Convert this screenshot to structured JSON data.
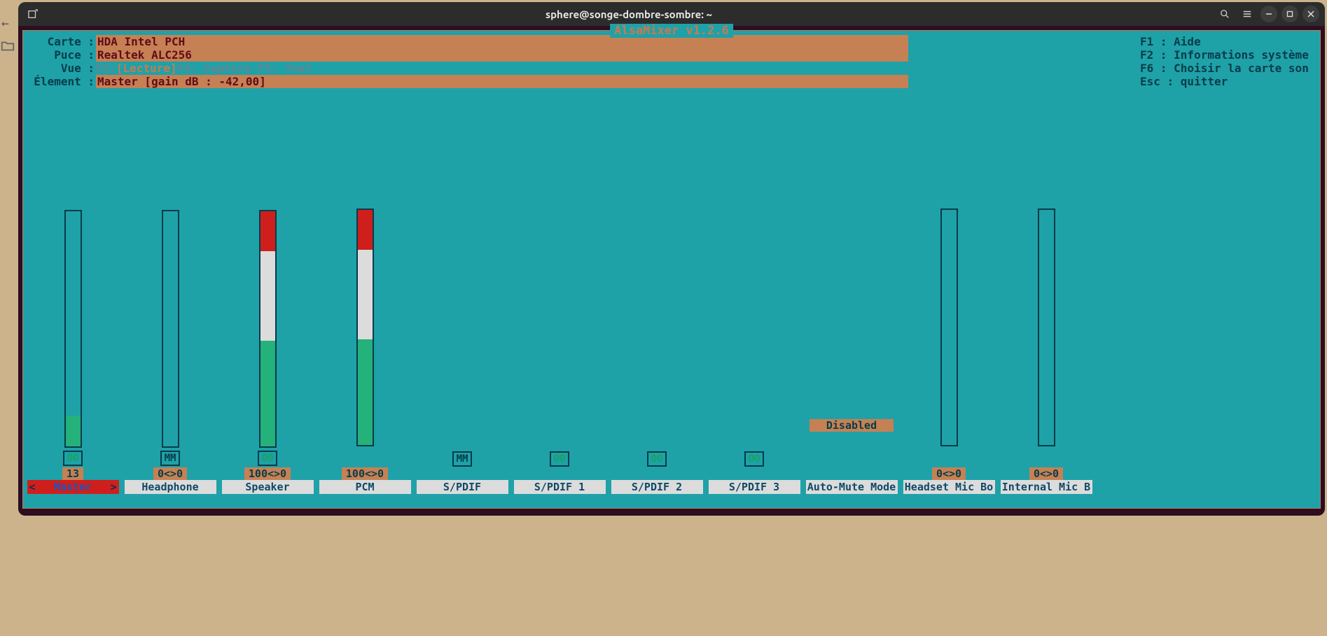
{
  "window": {
    "title": "sphere@songe-dombre-sombre: ~"
  },
  "alsamixer": {
    "frame_title": "AlsaMixer v1.2.6",
    "labels": {
      "carte": "Carte : ",
      "puce": "Puce : ",
      "vue": "Vue : ",
      "element": "Élement : "
    },
    "carte": "HDA Intel PCH",
    "puce": "Realtek ALC256",
    "view_prefix": "F3:",
    "view_selected": "[Lecture]",
    "view_rest": " F4: Capture  F5: Tout",
    "element": "Master [gain dB : -42,00]",
    "help": {
      "f1": "F1 :  Aide",
      "f2": "F2 :  Informations système",
      "f6": "F6 :  Choisir la carte son",
      "esc": "Esc : quitter"
    }
  },
  "channels": [
    {
      "name": "Master",
      "has_bar": true,
      "level": 13,
      "green": 13,
      "white": 0,
      "red": 0,
      "mute": "OO",
      "mute_cls": "mute-oo",
      "num": "13",
      "selected": true
    },
    {
      "name": "Headphone",
      "has_bar": true,
      "level": 0,
      "green": 0,
      "white": 0,
      "red": 0,
      "mute": "MM",
      "mute_cls": "mute-mm",
      "num": "0<>0"
    },
    {
      "name": "Speaker",
      "has_bar": true,
      "level": 100,
      "green": 45,
      "white": 38,
      "red": 17,
      "mute": "OO",
      "mute_cls": "mute-oo",
      "num": "100<>0"
    },
    {
      "name": "PCM",
      "has_bar": true,
      "level": 100,
      "green": 45,
      "white": 38,
      "red": 17,
      "mute": null,
      "num": "100<>0"
    },
    {
      "name": "S/PDIF",
      "has_bar": false,
      "mute": "MM",
      "mute_cls": "mute-mm"
    },
    {
      "name": "S/PDIF 1",
      "has_bar": false,
      "mute": "OO",
      "mute_cls": "mute-oo"
    },
    {
      "name": "S/PDIF 2",
      "has_bar": false,
      "mute": "OO",
      "mute_cls": "mute-oo"
    },
    {
      "name": "S/PDIF 3",
      "has_bar": false,
      "mute": "OO",
      "mute_cls": "mute-oo"
    },
    {
      "name": "Auto-Mute Mode",
      "has_bar": false,
      "disabled": "Disabled"
    },
    {
      "name": "Headset Mic Bo",
      "has_bar": true,
      "level": 0,
      "green": 0,
      "white": 0,
      "red": 0,
      "num": "0<>0"
    },
    {
      "name": "Internal Mic B",
      "has_bar": true,
      "level": 0,
      "green": 0,
      "white": 0,
      "red": 0,
      "num": "0<>0"
    }
  ]
}
